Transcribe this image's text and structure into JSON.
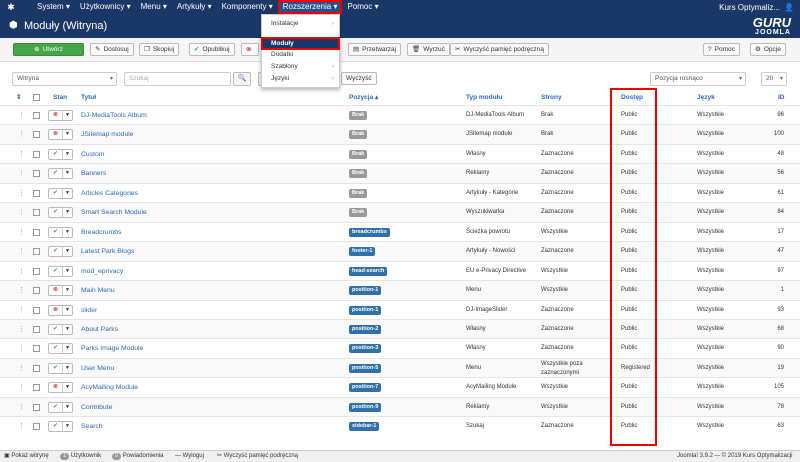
{
  "topnav": {
    "items": [
      "System",
      "Użytkownicy",
      "Menu",
      "Artykuły",
      "Komponenty",
      "Rozszerzenia",
      "Pomoc"
    ],
    "user": "Kurs Optymaliz..."
  },
  "header": {
    "title": "Moduły (Witryna)",
    "brand_line1": "GURU",
    "brand_line2": "JOOMLA"
  },
  "dropdown": {
    "items": [
      {
        "label": "Instalacje",
        "arrow": "›"
      },
      {
        "label": "Moduły",
        "arrow": ""
      },
      {
        "label": "Dodatki",
        "arrow": ""
      },
      {
        "label": "Szablony",
        "arrow": "›"
      },
      {
        "label": "Języki",
        "arrow": "›"
      }
    ]
  },
  "toolbar": {
    "new": "Utwórz",
    "edit": "Dostosuj",
    "copy": "Skopiuj",
    "publish": "Opublikuj",
    "batch": "Przetwarzaj",
    "trash": "Wyrzuć",
    "cache": "Wyczyść pamięć podręczną",
    "help": "Pomoc",
    "options": "Opcje"
  },
  "filters": {
    "client": "Witryna",
    "search_placeholder": "Szukaj",
    "clear": "Wyczyść",
    "sort": "Pozycja rosnąco",
    "limit": "20"
  },
  "columns": {
    "status": "Stan",
    "title": "Tytuł",
    "position": "Pozycja ▴",
    "type": "Typ modułu",
    "pages": "Strony",
    "access": "Dostęp",
    "language": "Język",
    "id": "ID"
  },
  "rows": [
    {
      "published": false,
      "title": "DJ-MediaTools Album",
      "position": "Brak",
      "pcolor": "#999999",
      "type": "DJ-MediaTools Album",
      "pages": "Brak",
      "access": "Public",
      "language": "Wszystkie",
      "id": "96"
    },
    {
      "published": false,
      "title": "JSitemap module",
      "position": "Brak",
      "pcolor": "#999999",
      "type": "JSitemap module",
      "pages": "Brak",
      "access": "Public",
      "language": "Wszystkie",
      "id": "100"
    },
    {
      "published": true,
      "title": "Custom",
      "position": "Brak",
      "pcolor": "#999999",
      "type": "Własny",
      "pages": "Zaznaczone",
      "access": "Public",
      "language": "Wszystkie",
      "id": "48"
    },
    {
      "published": true,
      "title": "Banners",
      "position": "Brak",
      "pcolor": "#999999",
      "type": "Reklamy",
      "pages": "Zaznaczone",
      "access": "Public",
      "language": "Wszystkie",
      "id": "56"
    },
    {
      "published": true,
      "title": "Articles Categories",
      "position": "Brak",
      "pcolor": "#999999",
      "type": "Artykuły - Kategorie",
      "pages": "Zaznaczone",
      "access": "Public",
      "language": "Wszystkie",
      "id": "61"
    },
    {
      "published": true,
      "title": "Smart Search Module",
      "position": "Brak",
      "pcolor": "#999999",
      "type": "Wyszukiwarka",
      "pages": "Zaznaczone",
      "access": "Public",
      "language": "Wszystkie",
      "id": "84"
    },
    {
      "published": true,
      "title": "Breadcrumbs",
      "position": "breadcrumbs",
      "pcolor": "#3071a9",
      "type": "Ścieżka powrotu",
      "pages": "Wszystkie",
      "access": "Public",
      "language": "Wszystkie",
      "id": "17"
    },
    {
      "published": true,
      "title": "Latest Park Blogs",
      "position": "footer-1",
      "pcolor": "#3071a9",
      "type": "Artykuły - Nowości",
      "pages": "Zaznaczone",
      "access": "Public",
      "language": "Wszystkie",
      "id": "47"
    },
    {
      "published": true,
      "title": "mod_eprivacy",
      "position": "head-search",
      "pcolor": "#3071a9",
      "type": "EU e-Privacy Directive",
      "pages": "Wszystkie",
      "access": "Public",
      "language": "Wszystkie",
      "id": "97"
    },
    {
      "published": false,
      "title": "Main Menu",
      "position": "position-1",
      "pcolor": "#3071a9",
      "type": "Menu",
      "pages": "Wszystkie",
      "access": "Public",
      "language": "Wszystkie",
      "id": "1"
    },
    {
      "published": false,
      "title": "slider",
      "position": "position-1",
      "pcolor": "#3071a9",
      "type": "DJ-ImageSlider",
      "pages": "Zaznaczone",
      "access": "Public",
      "language": "Wszystkie",
      "id": "93"
    },
    {
      "published": true,
      "title": "About Parks",
      "position": "position-2",
      "pcolor": "#3071a9",
      "type": "Własny",
      "pages": "Zaznaczone",
      "access": "Public",
      "language": "Wszystkie",
      "id": "68"
    },
    {
      "published": true,
      "title": "Parks Image Module",
      "position": "position-3",
      "pcolor": "#3071a9",
      "type": "Własny",
      "pages": "Zaznaczone",
      "access": "Public",
      "language": "Wszystkie",
      "id": "90"
    },
    {
      "published": true,
      "title": "User Menu",
      "position": "position-5",
      "pcolor": "#3071a9",
      "type": "Menu",
      "pages": "Wszystkie poza zaznaczonymi",
      "access": "Registered",
      "language": "Wszystkie",
      "id": "19"
    },
    {
      "published": false,
      "title": "AcyMailing Module",
      "position": "position-7",
      "pcolor": "#3071a9",
      "type": "AcyMailing Module",
      "pages": "Wszystkie",
      "access": "Public",
      "language": "Wszystkie",
      "id": "105"
    },
    {
      "published": true,
      "title": "Contribute",
      "position": "position-9",
      "pcolor": "#3071a9",
      "type": "Reklamy",
      "pages": "Wszystkie",
      "access": "Public",
      "language": "Wszystkie",
      "id": "78"
    },
    {
      "published": true,
      "title": "Search",
      "position": "sidebar-1",
      "pcolor": "#3071a9",
      "type": "Szukaj",
      "pages": "Zaznaczone",
      "access": "Public",
      "language": "Wszystkie",
      "id": "63"
    }
  ],
  "statusbar": {
    "view_site": "Pokaż witrynę",
    "users_count": "1",
    "users_label": "Użytkownik",
    "notif_count": "0",
    "notif_label": "Powiadomienia",
    "logout": "Wyloguj",
    "cache": "Wyczyść pamięć podręczną",
    "version": "Joomla! 3.9.2",
    "copyright": "— © 2019 Kurs Optymalizacji"
  },
  "colors": {
    "navbar": "#1a3867",
    "link": "#2a69b8",
    "highlight": "#ee0000",
    "publish_green": "#46a546",
    "unpublish_red": "#cc0000"
  }
}
